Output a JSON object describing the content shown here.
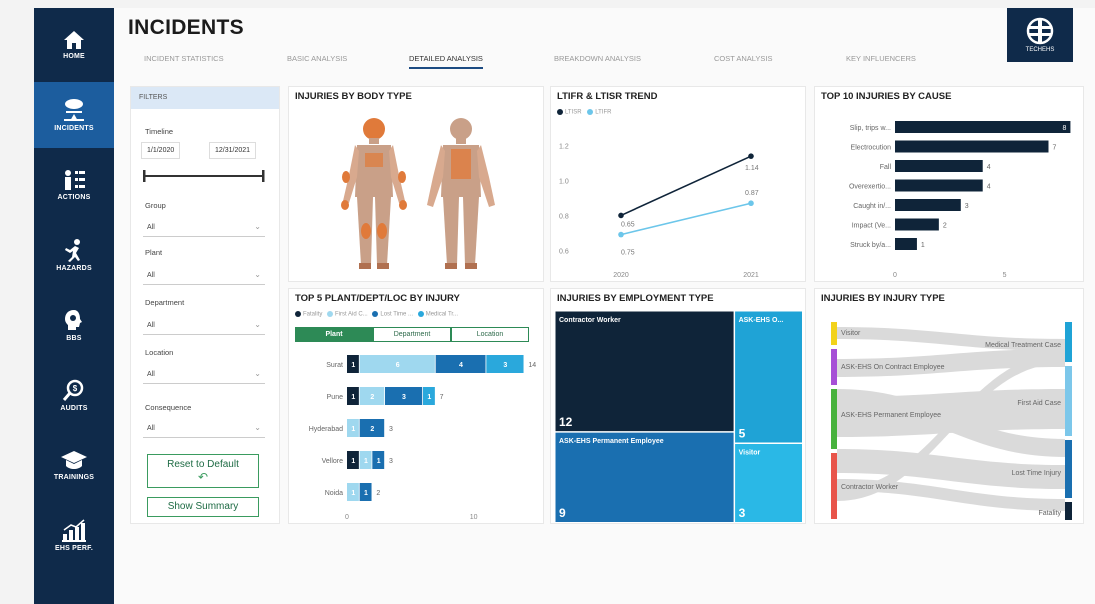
{
  "nav": [
    {
      "label": "HOME",
      "icon": "home-icon"
    },
    {
      "label": "INCIDENTS",
      "icon": "incidents-icon"
    },
    {
      "label": "ACTIONS",
      "icon": "actions-icon"
    },
    {
      "label": "HAZARDS",
      "icon": "hazards-icon"
    },
    {
      "label": "BBS",
      "icon": "bbs-icon"
    },
    {
      "label": "AUDITS",
      "icon": "audits-icon"
    },
    {
      "label": "TRAININGS",
      "icon": "trainings-icon"
    },
    {
      "label": "EHS PERF.",
      "icon": "ehs-perf-icon"
    }
  ],
  "page": {
    "title": "INCIDENTS"
  },
  "logo": {
    "text": "TECHEHS"
  },
  "tabs": [
    "INCIDENT STATISTICS",
    "BASIC ANALYSIS",
    "DETAILED ANALYSIS",
    "BREAKDOWN ANALYSIS",
    "COST ANALYSIS",
    "KEY INFLUENCERS"
  ],
  "filters": {
    "header": "FILTERS",
    "timeline_label": "Timeline",
    "date_from": "1/1/2020",
    "date_to": "12/31/2021",
    "group_label": "Group",
    "group_value": "All",
    "plant_label": "Plant",
    "plant_value": "All",
    "department_label": "Department",
    "department_value": "All",
    "location_label": "Location",
    "location_value": "All",
    "consequence_label": "Consequence",
    "consequence_value": "All",
    "reset_label": "Reset to Default",
    "reset_glyph": "↶",
    "summary_label": "Show Summary"
  },
  "panels": {
    "body": "INJURIES BY BODY TYPE",
    "trend": "LTIFR & LTISR TREND",
    "top10": "TOP 10 INJURIES BY CAUSE",
    "top5": "TOP 5 PLANT/DEPT/LOC BY INJURY",
    "employment": "INJURIES BY EMPLOYMENT TYPE",
    "injurytype": "INJURIES BY INJURY TYPE"
  },
  "trend_legend": [
    "LTISR",
    "LTIFR"
  ],
  "top5_legend": [
    "Fatality",
    "First Aid C...",
    "Lost Time ...",
    "Medical Tr..."
  ],
  "top5_toggles": [
    "Plant",
    "Department",
    "Location"
  ],
  "colors": {
    "navy": "#0f2a4a",
    "blue": "#1c5d9e",
    "dark": "#0f2439",
    "mid": "#1a6fb0",
    "light": "#7cc7ea",
    "cyan": "#1fa3d6",
    "sky": "#2aa8dc",
    "green": "#3a9b5f"
  },
  "chart_data": [
    {
      "type": "line",
      "title": "LTIFR & LTISR TREND",
      "x": [
        "2020",
        "2021"
      ],
      "series": [
        {
          "name": "LTISR",
          "values": [
            0.8,
            1.14
          ],
          "labels": [
            "",
            "1.14"
          ],
          "color": "#0f2439"
        },
        {
          "name": "LTIFR",
          "values": [
            0.69,
            0.87
          ],
          "labels": [
            "0.65",
            "0.87"
          ],
          "color": "#6cc6ea"
        }
      ],
      "extra_labels": [
        "0.75"
      ],
      "yticks": [
        "1.2",
        "1.0",
        "0.8",
        "0.6"
      ],
      "ylim": [
        0.55,
        1.25
      ]
    },
    {
      "type": "bar",
      "title": "TOP 10 INJURIES BY CAUSE",
      "categories": [
        "Slip, trips w...",
        "Electrocution",
        "Fall",
        "Overexertio...",
        "Caught in/...",
        "Impact (Ve...",
        "Struck by/a..."
      ],
      "values": [
        8,
        7,
        4,
        4,
        3,
        2,
        1
      ],
      "xticks": [
        "0",
        "5"
      ],
      "xlim": [
        0,
        8.3
      ]
    },
    {
      "type": "bar",
      "title": "TOP 5 PLANT/DEPT/LOC BY INJURY",
      "categories": [
        "Surat",
        "Pune",
        "Hyderabad",
        "Vellore",
        "Noida"
      ],
      "series": [
        {
          "name": "Fatality",
          "values": [
            1,
            1,
            0,
            1,
            0
          ],
          "color": "#0f2439"
        },
        {
          "name": "First Aid C...",
          "values": [
            6,
            2,
            1,
            1,
            1
          ],
          "color": "#9fd8ef"
        },
        {
          "name": "Lost Time ...",
          "values": [
            4,
            3,
            2,
            1,
            1
          ],
          "color": "#1a6fb0"
        },
        {
          "name": "Medical Tr...",
          "values": [
            3,
            1,
            0,
            0,
            0
          ],
          "color": "#2aa8dc"
        }
      ],
      "totals": [
        14,
        7,
        3,
        3,
        2
      ],
      "xticks": [
        "0",
        "10"
      ],
      "xlim": [
        0,
        15
      ]
    },
    {
      "type": "heatmap",
      "title": "INJURIES BY EMPLOYMENT TYPE",
      "categories": [
        "Contractor Worker",
        "ASK-EHS Permanent Employee",
        "ASK-EHS O...",
        "Visitor"
      ],
      "values": [
        12,
        9,
        5,
        3
      ]
    },
    {
      "type": "heatmap",
      "title": "INJURIES BY INJURY TYPE",
      "sources": [
        "Visitor",
        "ASK-EHS On Contract Employee",
        "ASK-EHS Permanent Employee",
        "Contractor Worker"
      ],
      "targets": [
        "Medical Treatment Case",
        "First Aid Case",
        "Lost Time Injury",
        "Fatality"
      ]
    }
  ]
}
